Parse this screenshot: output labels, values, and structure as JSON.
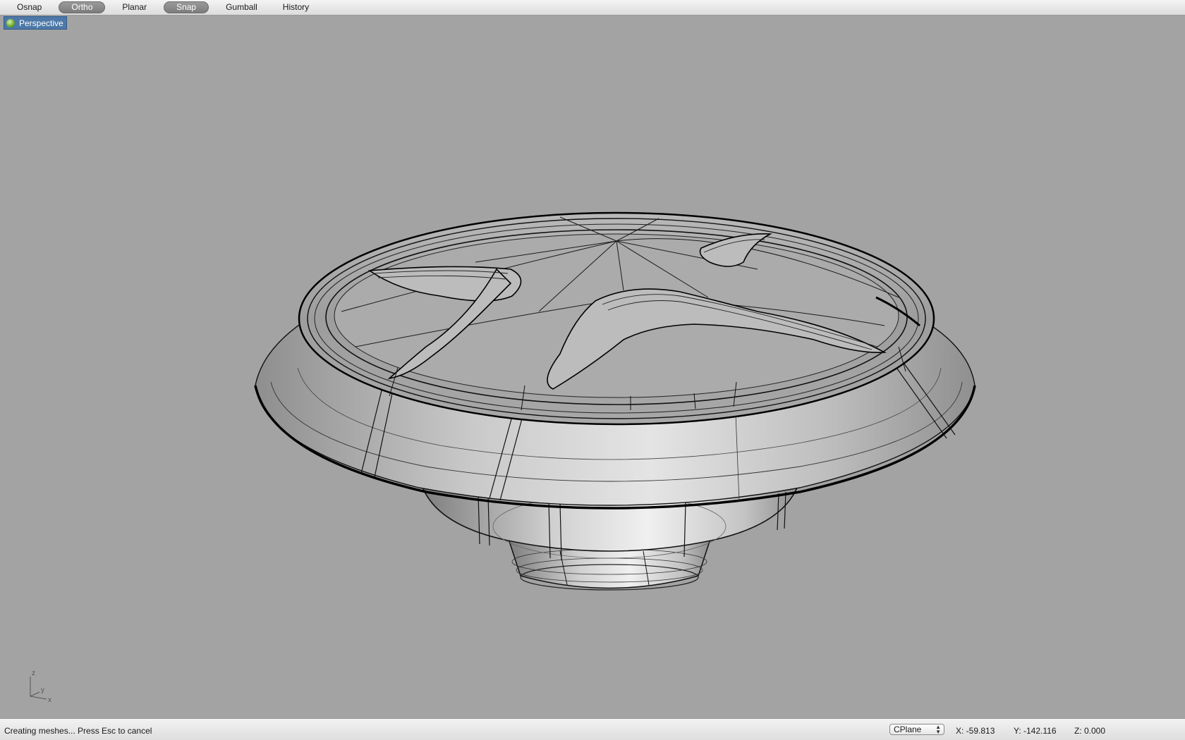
{
  "toolbar": {
    "items": [
      {
        "label": "Osnap",
        "active": false
      },
      {
        "label": "Ortho",
        "active": true
      },
      {
        "label": "Planar",
        "active": false
      },
      {
        "label": "Snap",
        "active": true
      },
      {
        "label": "Gumball",
        "active": false
      },
      {
        "label": "History",
        "active": false
      }
    ]
  },
  "viewport": {
    "title": "Perspective",
    "axes": {
      "z": "z",
      "y": "y",
      "x": "x"
    }
  },
  "status": {
    "message": "Creating meshes... Press Esc to cancel",
    "cplane": "CPlane",
    "x": "X: -59.813",
    "y": "Y: -142.116",
    "z": "Z: 0.000"
  },
  "colors": {
    "viewport_bg": "#a3a3a3",
    "tab_bg": "#4d78a8",
    "active_button": "#8a8a8a"
  }
}
